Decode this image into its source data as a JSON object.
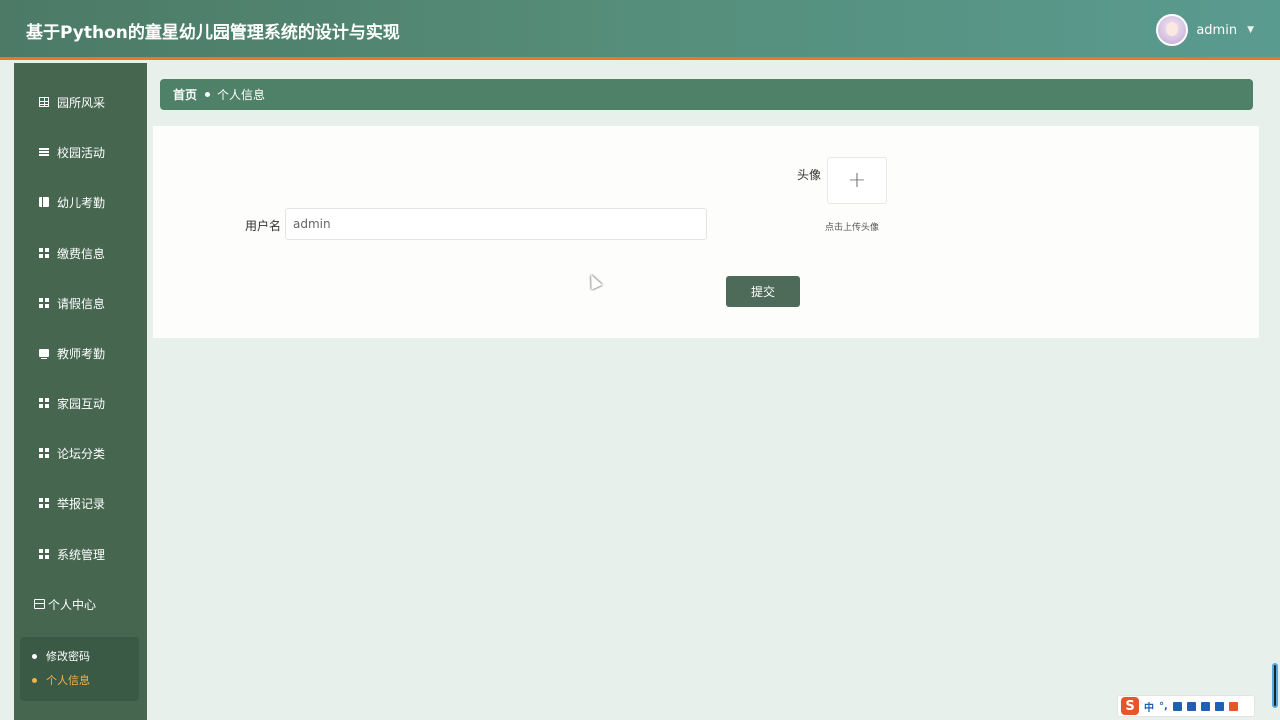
{
  "header": {
    "title": "基于Python的童星幼儿园管理系统的设计与实现",
    "username": "admin",
    "caret": "▼"
  },
  "sidebar": {
    "items": [
      {
        "label": "园所风采",
        "icon": "table-icon"
      },
      {
        "label": "校园活动",
        "icon": "list-icon"
      },
      {
        "label": "幼儿考勤",
        "icon": "book-icon"
      },
      {
        "label": "缴费信息",
        "icon": "grid-icon"
      },
      {
        "label": "请假信息",
        "icon": "grid-icon"
      },
      {
        "label": "教师考勤",
        "icon": "monitor-icon"
      },
      {
        "label": "家园互动",
        "icon": "grid-icon"
      },
      {
        "label": "论坛分类",
        "icon": "grid-icon"
      },
      {
        "label": "举报记录",
        "icon": "grid-icon"
      },
      {
        "label": "系统管理",
        "icon": "grid-icon"
      }
    ],
    "personal_center": {
      "label": "个人中心",
      "icon": "card-icon"
    },
    "submenu": [
      {
        "label": "修改密码",
        "active": false
      },
      {
        "label": "个人信息",
        "active": true
      }
    ],
    "active_color": "#f0b24a"
  },
  "breadcrumb": {
    "home": "首页",
    "current": "个人信息"
  },
  "form": {
    "username_label": "用户名",
    "username_value": "admin",
    "avatar_label": "头像",
    "upload_plus": "+",
    "upload_hint": "点击上传头像",
    "submit_label": "提交"
  },
  "ime": {
    "logo": "S",
    "mode": "中",
    "punct": "°,"
  },
  "colors": {
    "header_start": "#4c7a66",
    "header_end": "#5a9b90",
    "header_border": "#e9762b",
    "sidebar": "#466650",
    "breadcrumb": "#4f8068",
    "button": "#4d6b58"
  }
}
